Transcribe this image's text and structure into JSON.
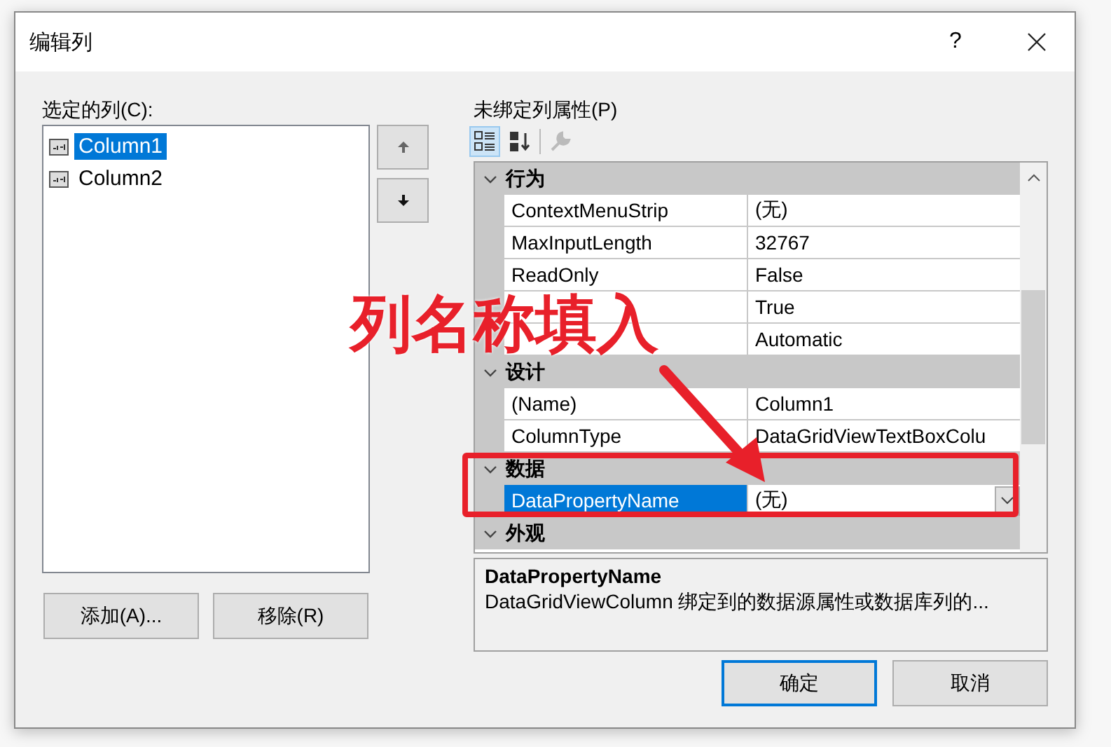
{
  "window": {
    "title": "编辑列",
    "help_button": "?"
  },
  "columns_list": {
    "label": "选定的列(C):",
    "items": [
      {
        "name": "Column1",
        "selected": true
      },
      {
        "name": "Column2",
        "selected": false
      }
    ]
  },
  "list_buttons": [
    "添加(A)...",
    "移除(R)"
  ],
  "properties": {
    "label": "未绑定列属性(P)",
    "toolbar": [
      {
        "kind": "categorized",
        "selected": true,
        "disabled": false
      },
      {
        "kind": "alphabetical",
        "selected": false,
        "disabled": false
      },
      {
        "kind": "property_pages",
        "selected": false,
        "disabled": true
      }
    ],
    "categories": [
      {
        "name": "行为",
        "expanded": true,
        "rows": [
          {
            "name": "ContextMenuStrip",
            "value": "(无)",
            "selected": false
          },
          {
            "name": "MaxInputLength",
            "value": "32767",
            "selected": false
          },
          {
            "name": "ReadOnly",
            "value": "False",
            "selected": false
          },
          {
            "value": "True",
            "selected": false
          },
          {
            "value": "Automatic",
            "selected": false
          }
        ]
      },
      {
        "name": "设计",
        "expanded": true,
        "rows": [
          {
            "name": "(Name)",
            "value": "Column1",
            "selected": false
          },
          {
            "name": "ColumnType",
            "value": "DataGridViewTextBoxColu",
            "selected": false
          }
        ]
      },
      {
        "name": "数据",
        "expanded": true,
        "rows": [
          {
            "name": "DataPropertyName",
            "value": "(无)",
            "selected": true
          }
        ]
      },
      {
        "name": "外观",
        "expanded": true
      }
    ],
    "description": {
      "title": "DataPropertyName",
      "text": "DataGridViewColumn 绑定到的数据源属性或数据库列的..."
    }
  },
  "buttons": [
    {
      "label": "确定",
      "default": true
    },
    {
      "label": "取消",
      "default": false
    }
  ],
  "annotation": {
    "text": "列名称填入"
  }
}
